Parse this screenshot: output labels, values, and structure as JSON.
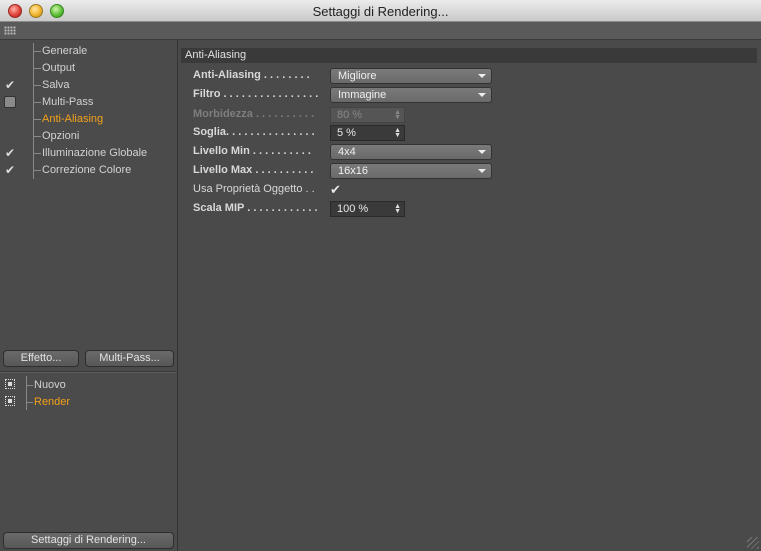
{
  "window": {
    "title": "Settaggi di Rendering..."
  },
  "nav": {
    "items": [
      {
        "label": "Generale",
        "check": "none",
        "active": false
      },
      {
        "label": "Output",
        "check": "none",
        "active": false
      },
      {
        "label": "Salva",
        "check": "checked",
        "active": false
      },
      {
        "label": "Multi-Pass",
        "check": "unchecked",
        "active": false
      },
      {
        "label": "Anti-Aliasing",
        "check": "none",
        "active": true
      },
      {
        "label": "Opzioni",
        "check": "none",
        "active": false
      },
      {
        "label": "Illuminazione Globale",
        "check": "checked",
        "active": false
      },
      {
        "label": "Correzione Colore",
        "check": "checked",
        "active": false
      }
    ]
  },
  "buttons": {
    "effetto": "Effetto...",
    "multipass": "Multi-Pass...",
    "render_settings": "Settaggi di Rendering..."
  },
  "render_list": [
    {
      "label": "Nuovo",
      "active": false
    },
    {
      "label": "Render",
      "active": true
    }
  ],
  "section": {
    "title": "Anti-Aliasing"
  },
  "fields": {
    "antialiasing": {
      "label": "Anti-Aliasing . . . . . . . .",
      "value": "Migliore"
    },
    "filtro": {
      "label": "Filtro . . . . . . . . . . . . . . . .",
      "value": "Immagine"
    },
    "morbidezza": {
      "label": "Morbidezza . . . . . . . . . .",
      "value": "80 %"
    },
    "soglia": {
      "label": "Soglia. . . . . . . . . . . . . . .",
      "value": "5 %"
    },
    "livello_min": {
      "label": "Livello Min . . . . . . . . . .",
      "value": "4x4"
    },
    "livello_max": {
      "label": "Livello Max . . . . . . . . . .",
      "value": "16x16"
    },
    "usa_proprieta": {
      "label": "Usa Proprietà Oggetto . .",
      "checked": "✔"
    },
    "scala_mip": {
      "label": "Scala MIP . . . . . . . . . . . .",
      "value": "100 %"
    }
  },
  "icons": {
    "check": "check-icon",
    "spin": "spin-arrows-icon",
    "dropdown": "chevron-down-icon"
  }
}
